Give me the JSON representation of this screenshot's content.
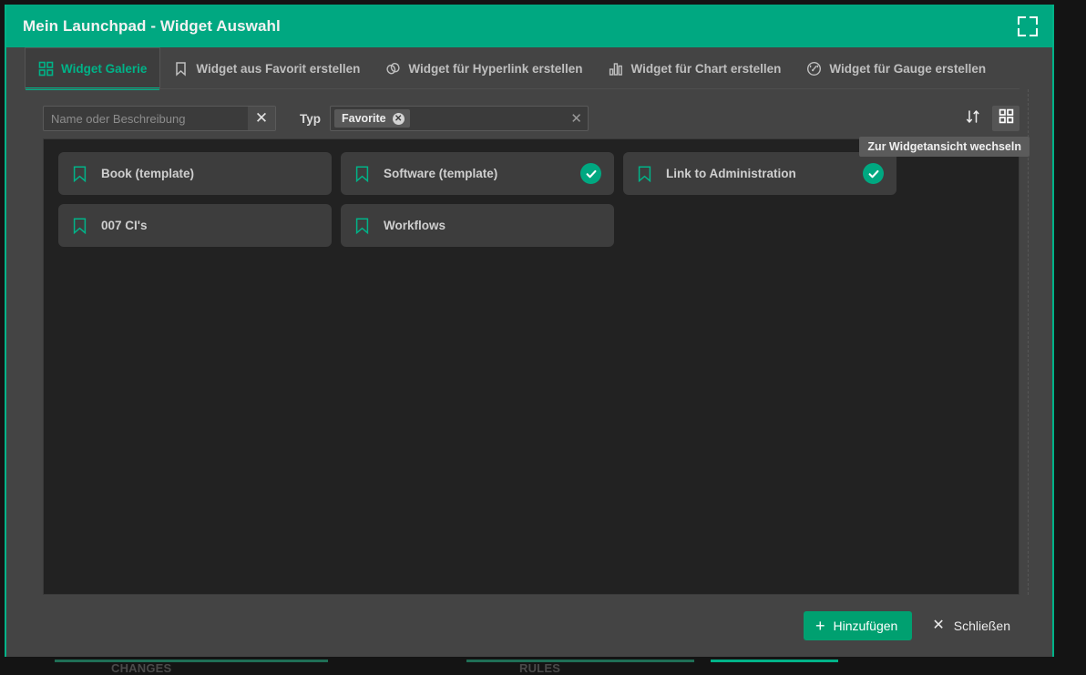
{
  "window": {
    "title": "Mein Launchpad - Widget Auswahl",
    "fullscreen_icon": "fullscreen-icon",
    "accent_color": "#00b388",
    "titlebar_color": "#00a881",
    "body_color": "#444444",
    "gallery_color": "#222222"
  },
  "tabs": [
    {
      "label": "Widget Galerie",
      "icon": "grid-icon",
      "active": true
    },
    {
      "label": "Widget aus Favorit erstellen",
      "icon": "bookmark-icon",
      "active": false
    },
    {
      "label": "Widget für Hyperlink erstellen",
      "icon": "link-icon",
      "active": false
    },
    {
      "label": "Widget für Chart erstellen",
      "icon": "bar-chart-icon",
      "active": false
    },
    {
      "label": "Widget für Gauge erstellen",
      "icon": "gauge-icon",
      "active": false
    }
  ],
  "toolbar": {
    "search": {
      "placeholder": "Name oder Beschreibung",
      "value": "",
      "clear_icon": "close-icon"
    },
    "type_filter": {
      "label": "Typ",
      "chips": [
        {
          "label": "Favorite",
          "remove_icon": "chip-remove-icon"
        }
      ],
      "clear_icon": "close-icon"
    },
    "sort_button": {
      "icon": "sort-arrows-icon"
    },
    "view_button": {
      "icon": "grid-view-icon",
      "active": true
    },
    "tooltip": "Zur Widgetansicht wechseln"
  },
  "gallery": {
    "cards": [
      {
        "label": "Book (template)",
        "icon": "bookmark-icon",
        "selected": false
      },
      {
        "label": "Software (template)",
        "icon": "bookmark-icon",
        "selected": true
      },
      {
        "label": "Link to Administration",
        "icon": "bookmark-icon",
        "selected": true
      },
      {
        "label": "007 CI's",
        "icon": "bookmark-icon",
        "selected": false
      },
      {
        "label": "Workflows",
        "icon": "bookmark-icon",
        "selected": false
      }
    ]
  },
  "footer": {
    "add_label": "Hinzufügen",
    "add_icon": "plus-icon",
    "close_label": "Schließen",
    "close_icon": "close-icon"
  }
}
